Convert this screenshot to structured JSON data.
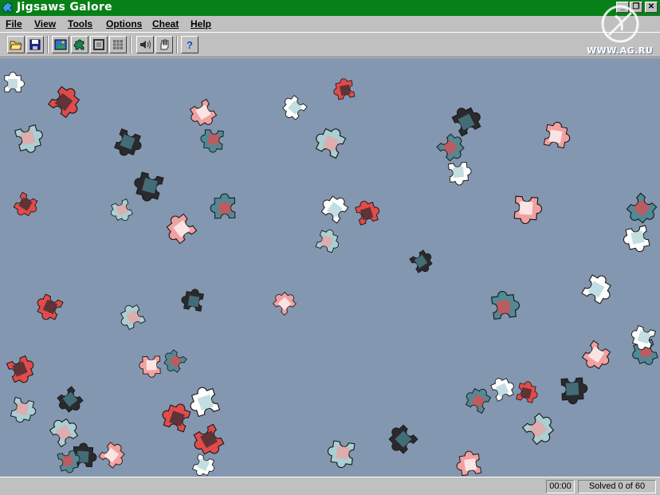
{
  "window": {
    "title": "Jigsaws Galore",
    "controls": [
      "minimize",
      "restore",
      "close"
    ]
  },
  "menu": [
    {
      "label": "File",
      "accel": "F"
    },
    {
      "label": "View",
      "accel": "V"
    },
    {
      "label": "Tools",
      "accel": "T"
    },
    {
      "label": "Options",
      "accel": "O"
    },
    {
      "label": "Cheat",
      "accel": "C"
    },
    {
      "label": "Help",
      "accel": "H"
    }
  ],
  "toolbar": [
    {
      "name": "open-icon"
    },
    {
      "name": "save-icon"
    },
    {
      "name": "picture-icon"
    },
    {
      "name": "piece-icon"
    },
    {
      "name": "edges-icon"
    },
    {
      "name": "grid-icon"
    },
    {
      "name": "sound-icon"
    },
    {
      "name": "hand-icon"
    },
    {
      "name": "help-icon"
    }
  ],
  "watermark": "WWW.AG.RU",
  "board": {
    "background": "#8497b0",
    "piece_colors": [
      "#ffffff",
      "#e24b4b",
      "#a9d0d4",
      "#2a2a2e",
      "#f2a0a0",
      "#4f8a96"
    ]
  },
  "status": {
    "timer": "00:00",
    "solved": "Solved 0 of 60"
  }
}
